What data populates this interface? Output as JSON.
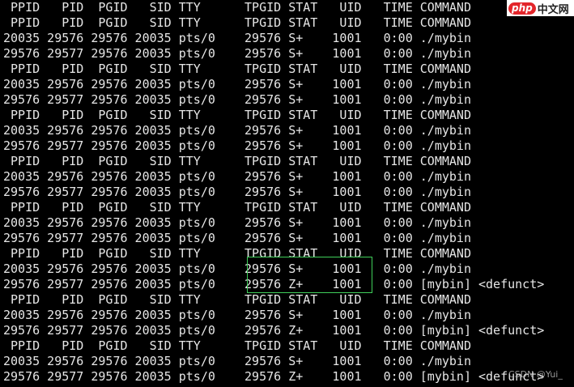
{
  "terminal": {
    "lines": [
      " PPID   PID  PGID   SID TTY      TPGID STAT   UID   TIME COMMAND",
      " PPID   PID  PGID   SID TTY      TPGID STAT   UID   TIME COMMAND",
      "20035 29576 29576 20035 pts/0    29576 S+    1001   0:00 ./mybin",
      "29576 29577 29576 20035 pts/0    29576 S+    1001   0:00 ./mybin",
      " PPID   PID  PGID   SID TTY      TPGID STAT   UID   TIME COMMAND",
      "20035 29576 29576 20035 pts/0    29576 S+    1001   0:00 ./mybin",
      "29576 29577 29576 20035 pts/0    29576 S+    1001   0:00 ./mybin",
      " PPID   PID  PGID   SID TTY      TPGID STAT   UID   TIME COMMAND",
      "20035 29576 29576 20035 pts/0    29576 S+    1001   0:00 ./mybin",
      "29576 29577 29576 20035 pts/0    29576 S+    1001   0:00 ./mybin",
      " PPID   PID  PGID   SID TTY      TPGID STAT   UID   TIME COMMAND",
      "20035 29576 29576 20035 pts/0    29576 S+    1001   0:00 ./mybin",
      "29576 29577 29576 20035 pts/0    29576 S+    1001   0:00 ./mybin",
      " PPID   PID  PGID   SID TTY      TPGID STAT   UID   TIME COMMAND",
      "20035 29576 29576 20035 pts/0    29576 S+    1001   0:00 ./mybin",
      "29576 29577 29576 20035 pts/0    29576 S+    1001   0:00 ./mybin",
      " PPID   PID  PGID   SID TTY      TPGID STAT   UID   TIME COMMAND",
      "20035 29576 29576 20035 pts/0    29576 S+    1001   0:00 ./mybin",
      "29576 29577 29576 20035 pts/0    29576 Z+    1001   0:00 [mybin] <defunct>",
      " PPID   PID  PGID   SID TTY      TPGID STAT   UID   TIME COMMAND",
      "20035 29576 29576 20035 pts/0    29576 S+    1001   0:00 ./mybin",
      "29576 29577 29576 20035 pts/0    29576 Z+    1001   0:00 [mybin] <defunct>",
      " PPID   PID  PGID   SID TTY      TPGID STAT   UID   TIME COMMAND",
      "20035 29576 29576 20035 pts/0    29576 S+    1001   0:00 ./mybin",
      "29576 29577 29576 20035 pts/0    29576 Z+    1001   0:00 [mybin] <defunct>"
    ]
  },
  "logo": {
    "php": "php",
    "cn": "中文网"
  },
  "watermark": "CSDN @Yui_",
  "colors": {
    "highlight": "#3fcf5a",
    "text": "#e6e6e6",
    "background": "#000000"
  }
}
